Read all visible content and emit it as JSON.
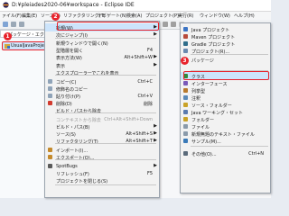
{
  "window": {
    "title": "D:¥pleiades2020-06¥workspace - Eclipse IDE"
  },
  "menubar": [
    "ァイル(F)",
    "編集(E)",
    "ソース(S)",
    "リファクタリング(T)",
    "ナビゲート(N)",
    "検索(A)",
    "プロジェクト(P)",
    "実行(R)",
    "ウィンドウ(W)",
    "ヘルプ(H)"
  ],
  "explorer": {
    "title": "パッケージ・エクスプロー",
    "project": "UsualJavaProject"
  },
  "badges": [
    "1",
    "2",
    "3"
  ],
  "context_menu": {
    "items": [
      {
        "label": "新規(W)",
        "shortcut": "",
        "arrow": true,
        "disabled": false,
        "icon": "",
        "selected": true
      },
      {
        "label": "次にジャンプ(I)",
        "shortcut": "",
        "arrow": true,
        "disabled": false,
        "icon": ""
      },
      {
        "label": "新規ウィンドウで開く(N)",
        "shortcut": "",
        "arrow": false,
        "disabled": false,
        "icon": ""
      },
      {
        "label": "型階層を開く",
        "shortcut": "F4",
        "arrow": false,
        "disabled": false,
        "icon": ""
      },
      {
        "label": "表示方法(W)",
        "shortcut": "Alt+Shift+W",
        "arrow": true,
        "disabled": false,
        "icon": ""
      },
      {
        "label": "表示",
        "shortcut": "",
        "arrow": true,
        "disabled": false,
        "icon": ""
      },
      {
        "label": "エクスプローラーでこれを表示",
        "shortcut": "",
        "arrow": false,
        "disabled": false,
        "icon": ""
      },
      {
        "label": "コピー(C)",
        "shortcut": "Ctrl+C",
        "arrow": false,
        "disabled": false,
        "icon": "#8fa3b8"
      },
      {
        "label": "修飾名のコピー",
        "shortcut": "",
        "arrow": false,
        "disabled": false,
        "icon": "#8fa3b8"
      },
      {
        "label": "貼り付け(P)",
        "shortcut": "Ctrl+V",
        "arrow": false,
        "disabled": false,
        "icon": "#8fa3b8"
      },
      {
        "label": "削除(D)",
        "shortcut": "削除",
        "arrow": false,
        "disabled": false,
        "icon": "#d23b2f"
      },
      {
        "label": "ビルド・パスから除去",
        "shortcut": "",
        "arrow": false,
        "disabled": false,
        "icon": ""
      },
      {
        "label": "コンテキストから除去",
        "shortcut": "Ctrl+Alt+Shift+Down",
        "arrow": false,
        "disabled": true,
        "icon": ""
      },
      {
        "label": "ビルド・パス(B)",
        "shortcut": "",
        "arrow": true,
        "disabled": false,
        "icon": ""
      },
      {
        "label": "ソース(S)",
        "shortcut": "Alt+Shift+S",
        "arrow": true,
        "disabled": false,
        "icon": ""
      },
      {
        "label": "リファクタリング(T)",
        "shortcut": "Alt+Shift+T",
        "arrow": true,
        "disabled": false,
        "icon": ""
      },
      {
        "label": "インポート(I)...",
        "shortcut": "",
        "arrow": false,
        "disabled": false,
        "icon": "#c48a2c"
      },
      {
        "label": "エクスポート(O)...",
        "shortcut": "",
        "arrow": false,
        "disabled": false,
        "icon": "#c48a2c"
      },
      {
        "label": "SpotBugs",
        "shortcut": "",
        "arrow": true,
        "disabled": false,
        "icon": "#5a5a5a"
      },
      {
        "label": "リフレッシュ(F)",
        "shortcut": "F5",
        "arrow": false,
        "disabled": false,
        "icon": ""
      },
      {
        "label": "プロジェクトを閉じる(S)",
        "shortcut": "",
        "arrow": false,
        "disabled": false,
        "icon": ""
      }
    ]
  },
  "submenu": {
    "items": [
      {
        "label": "Java プロジェクト",
        "icon": "#3b74c4"
      },
      {
        "label": "Maven プロジェクト",
        "icon": "#b84a3a"
      },
      {
        "label": "Gradle プロジェクト",
        "icon": "#2f6d8a"
      },
      {
        "label": "プロジェクト(R)...",
        "icon": "#6a8ab0"
      },
      {
        "label": "パッケージ",
        "icon": "#c9a227"
      },
      {
        "label": "クラス",
        "icon": "#2e8b3e",
        "selected": true
      },
      {
        "label": "インターフェース",
        "icon": "#7a5ab8"
      },
      {
        "label": "列挙型",
        "icon": "#b87a2c"
      },
      {
        "label": "注釈",
        "icon": "#5a8ab8"
      },
      {
        "label": "ソース・フォルダー",
        "icon": "#c9a227"
      },
      {
        "label": "Java ワーキング・セット",
        "icon": "#5a7ab0"
      },
      {
        "label": "フォルダー",
        "icon": "#c9a227"
      },
      {
        "label": "ファイル",
        "icon": "#8a9aaa"
      },
      {
        "label": "新規無題のテキスト・ファイル",
        "icon": "#8a9aaa"
      },
      {
        "label": "サンプル(M)...",
        "icon": "#3a7ab8"
      },
      {
        "label": "その他(O)...",
        "shortcut": "Ctrl+N",
        "icon": "#5a6a7a"
      }
    ]
  }
}
